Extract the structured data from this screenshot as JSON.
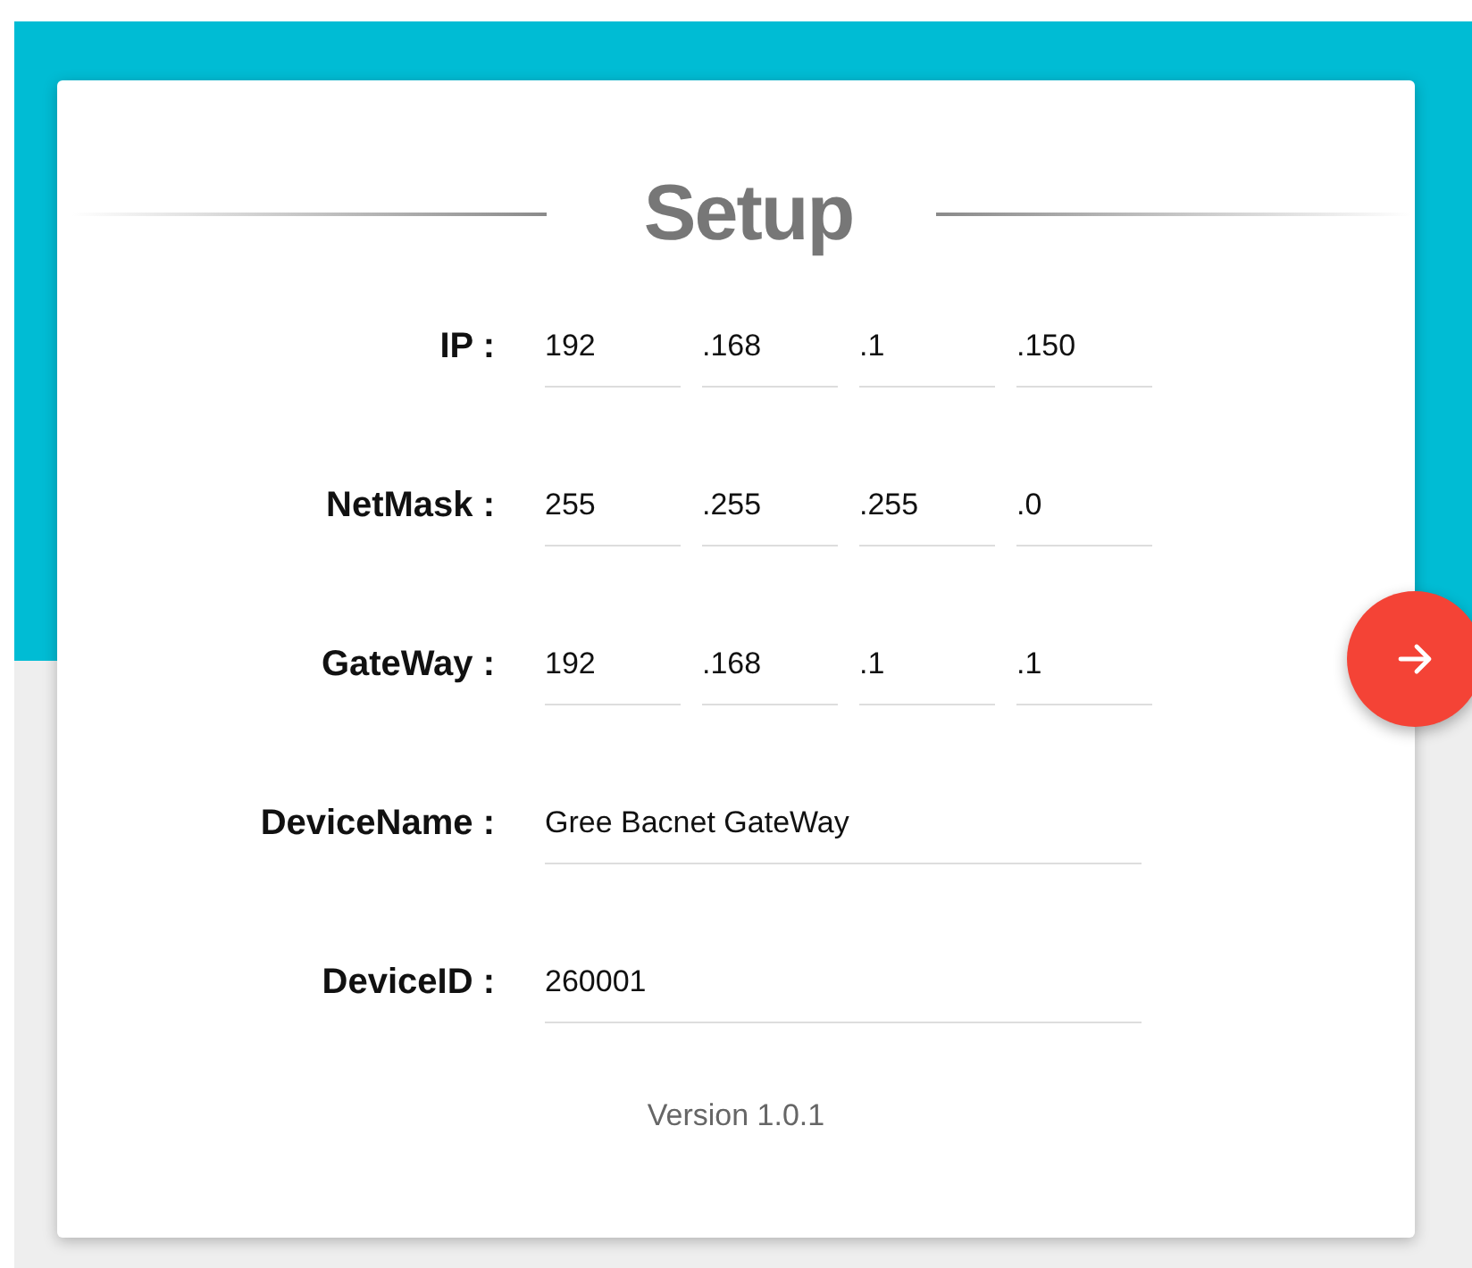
{
  "title": "Setup",
  "fields": [
    {
      "label": "IP :",
      "kind": "octets",
      "values": [
        "192",
        ".168",
        ".1",
        ".150"
      ]
    },
    {
      "label": "NetMask :",
      "kind": "octets",
      "values": [
        "255",
        ".255",
        ".255",
        ".0"
      ]
    },
    {
      "label": "GateWay :",
      "kind": "octets",
      "values": [
        "192",
        ".168",
        ".1",
        ".1"
      ]
    },
    {
      "label": "DeviceName :",
      "kind": "text",
      "value": "Gree Bacnet GateWay"
    },
    {
      "label": "DeviceID :",
      "kind": "text",
      "value": "260001"
    }
  ],
  "version": "Version 1.0.1"
}
